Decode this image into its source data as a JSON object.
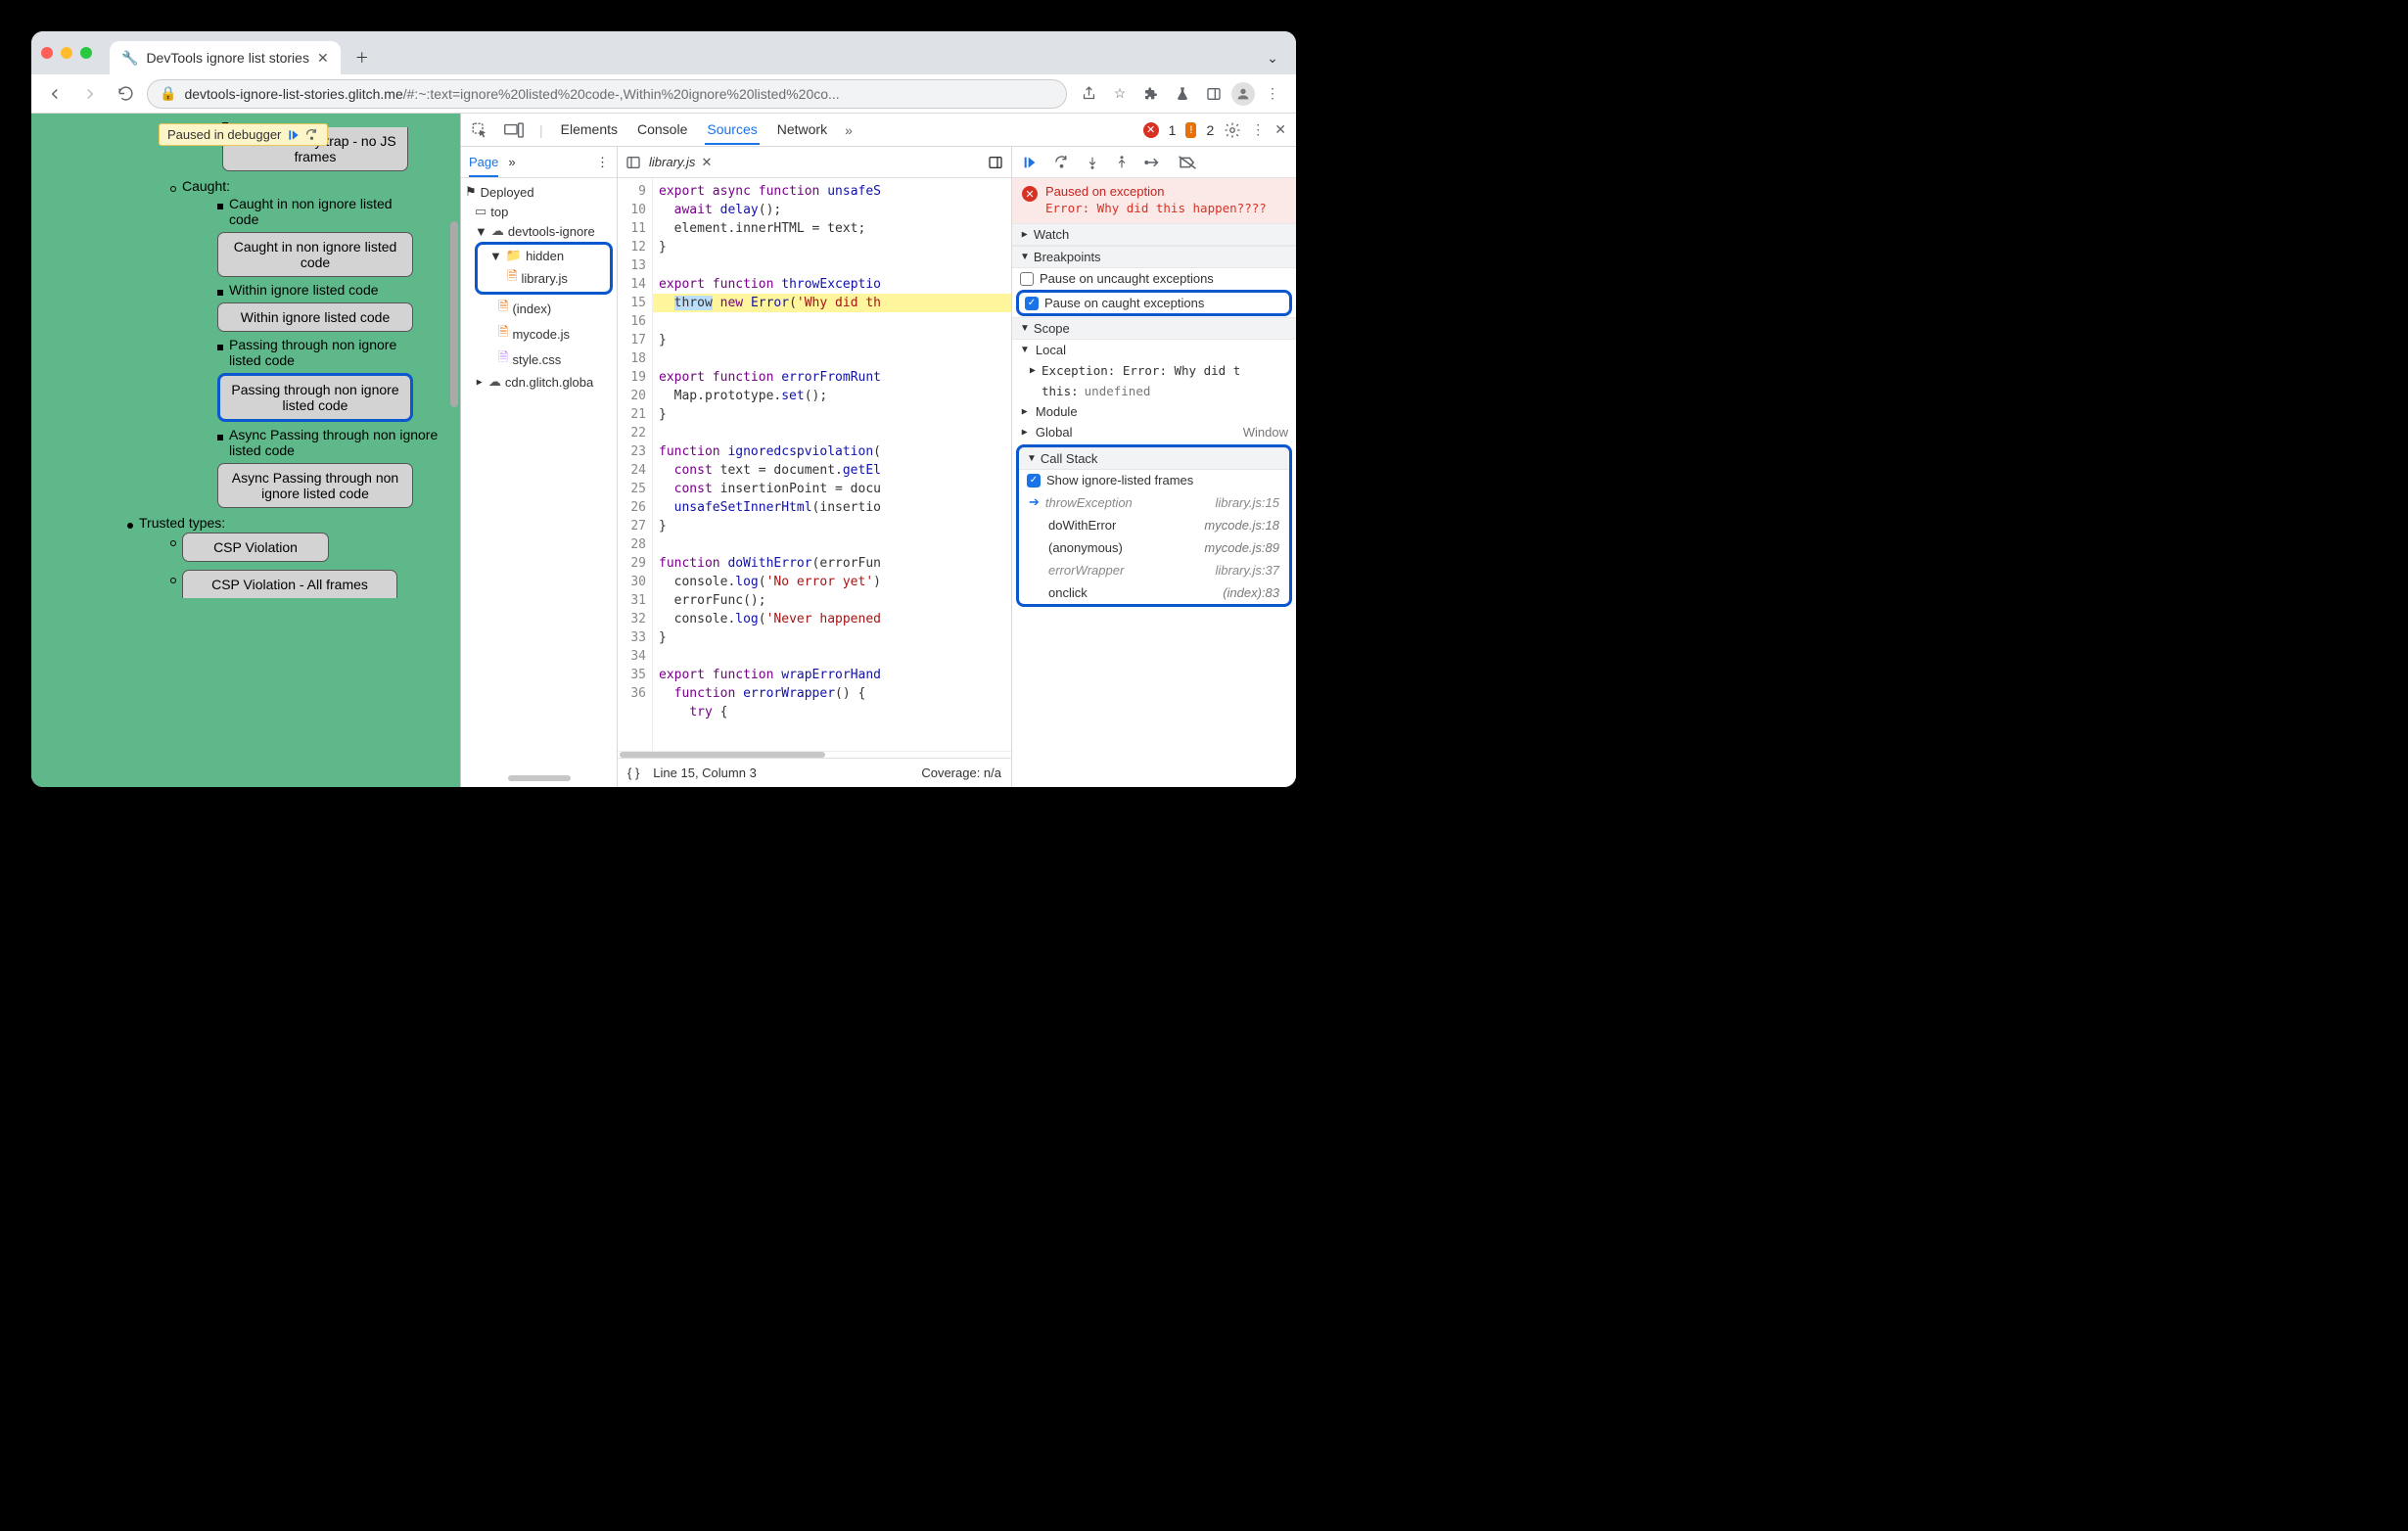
{
  "browser": {
    "tab_title": "DevTools ignore list stories",
    "url_dark": "devtools-ignore-list-stories.glitch.me",
    "url_dim": "/#:~:text=ignore%20listed%20code-,Within%20ignore%20listed%20co..."
  },
  "paused_pill": "Paused in debugger",
  "page": {
    "wasm_btn": "WebAssembly trap - no JS frames",
    "caught_heading": "Caught:",
    "item1": "Caught in non ignore listed code",
    "btn1": "Caught in non ignore listed code",
    "item2": "Within ignore listed code",
    "btn2": "Within ignore listed code",
    "item3": "Passing through non ignore listed code",
    "btn3": "Passing through non ignore listed code",
    "item4": "Async Passing through non ignore listed code",
    "btn4": "Async Passing through non ignore listed code",
    "trusted": "Trusted types:",
    "csp1": "CSP Violation",
    "csp2": "CSP Violation - All frames"
  },
  "devtools": {
    "tabs": {
      "elements": "Elements",
      "console": "Console",
      "sources": "Sources",
      "network": "Network"
    },
    "err_count": "1",
    "warn_count": "2",
    "nav": {
      "page": "Page",
      "deployed": "Deployed",
      "top": "top",
      "domain": "devtools-ignore",
      "hidden": "hidden",
      "library": "library.js",
      "index": "(index)",
      "mycode": "mycode.js",
      "style": "style.css",
      "cdn": "cdn.glitch.globa"
    },
    "file_tab": "library.js",
    "gutter_start": 9,
    "gutter_end": 36,
    "code_lines": [
      "export async function unsafeS",
      "  await delay();",
      "  element.innerHTML = text;",
      "}",
      "",
      "export function throwExceptio",
      "  throw new Error('Why did th",
      "}",
      "",
      "export function errorFromRunt",
      "  Map.prototype.set();",
      "}",
      "",
      "function ignoredcspviolation(",
      "  const text = document.getEl",
      "  const insertionPoint = docu",
      "  unsafeSetInnerHtml(insertio",
      "}",
      "",
      "function doWithError(errorFun",
      "  console.log('No error yet')",
      "  errorFunc();",
      "  console.log('Never happened",
      "}",
      "",
      "export function wrapErrorHand",
      "  function errorWrapper() {",
      "    try {"
    ],
    "status": {
      "line": "Line 15, Column 3",
      "coverage": "Coverage: n/a"
    },
    "pause": {
      "title": "Paused on exception",
      "err": "Error: Why did this happen????"
    },
    "sections": {
      "watch": "Watch",
      "breakpoints": "Breakpoints",
      "scope": "Scope",
      "callstack": "Call Stack",
      "module": "Module",
      "global": "Global",
      "global_v": "Window",
      "local": "Local"
    },
    "bkpts": {
      "uncaught": "Pause on uncaught exceptions",
      "caught": "Pause on caught exceptions"
    },
    "scope": {
      "exception": "Exception: Error: Why did t",
      "this": "this: ",
      "this_v": "undefined"
    },
    "stack": {
      "show": "Show ignore-listed frames",
      "rows": [
        {
          "fn": "throwException",
          "loc": "library.js:15",
          "ign": true,
          "cur": true
        },
        {
          "fn": "doWithError",
          "loc": "mycode.js:18",
          "ign": false
        },
        {
          "fn": "(anonymous)",
          "loc": "mycode.js:89",
          "ign": false
        },
        {
          "fn": "errorWrapper",
          "loc": "library.js:37",
          "ign": true
        },
        {
          "fn": "onclick",
          "loc": "(index):83",
          "ign": false
        }
      ]
    }
  }
}
